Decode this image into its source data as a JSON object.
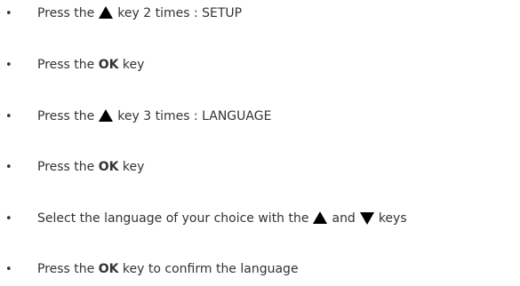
{
  "bullet": "•",
  "steps": [
    {
      "p1": "Press the",
      "icon": "up-triangle-icon",
      "p2": "key 2 times : SETUP"
    },
    {
      "p1": "Press the ",
      "bold": "OK",
      "p2": " key"
    },
    {
      "p1": "Press the",
      "icon": "up-triangle-icon",
      "p2": "key 3 times : LANGUAGE"
    },
    {
      "p1": "Press the ",
      "bold": "OK",
      "p2": " key"
    },
    {
      "p1": "Select the language of your choice with the",
      "icon": "up-triangle-icon",
      "p2": "and",
      "icon2": "down-triangle-icon",
      "p3": "keys"
    },
    {
      "p1": "Press the ",
      "bold": "OK",
      "p2": " key to confirm the language"
    }
  ],
  "colors": {
    "text": "#333333",
    "icon": "#000000"
  }
}
